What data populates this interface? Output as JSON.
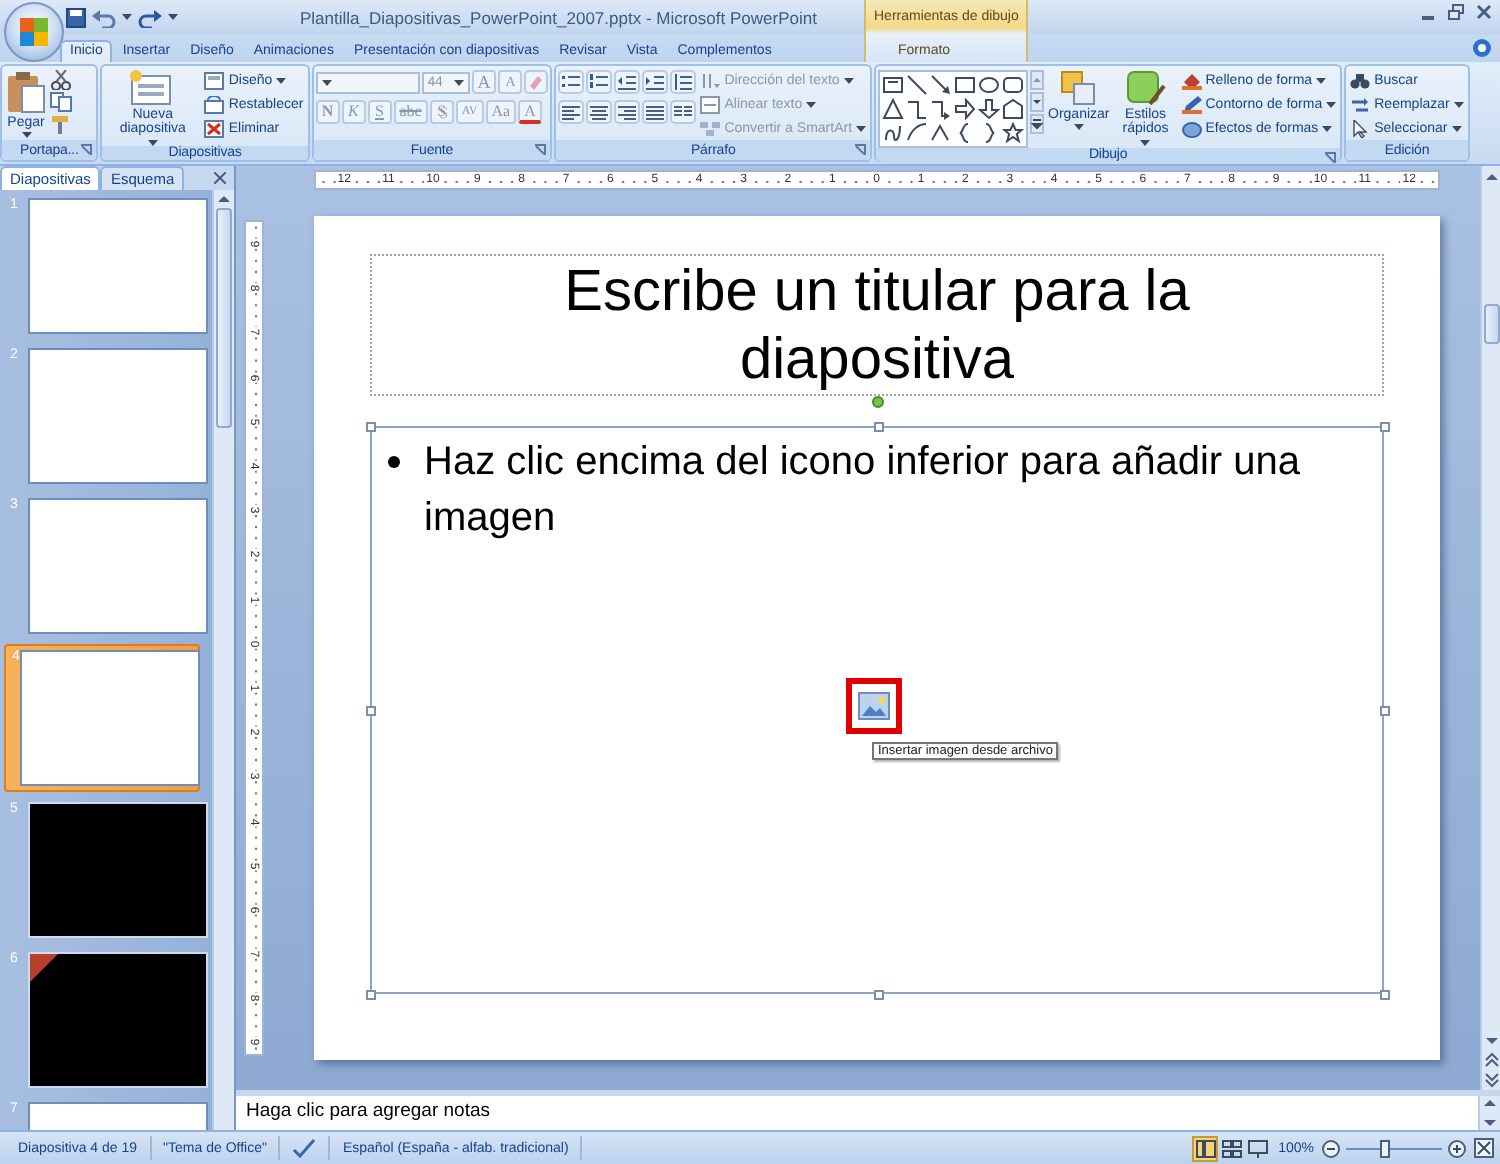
{
  "window": {
    "title": "Plantilla_Diapositivas_PowerPoint_2007.pptx - Microsoft PowerPoint",
    "contextual_group": "Herramientas de dibujo"
  },
  "tabs": [
    {
      "label": "Inicio",
      "selected": true,
      "contextual": false
    },
    {
      "label": "Insertar",
      "selected": false,
      "contextual": false
    },
    {
      "label": "Diseño",
      "selected": false,
      "contextual": false
    },
    {
      "label": "Animaciones",
      "selected": false,
      "contextual": false
    },
    {
      "label": "Presentación con diapositivas",
      "selected": false,
      "contextual": false
    },
    {
      "label": "Revisar",
      "selected": false,
      "contextual": false
    },
    {
      "label": "Vista",
      "selected": false,
      "contextual": false
    },
    {
      "label": "Complementos",
      "selected": false,
      "contextual": false
    },
    {
      "label": "Formato",
      "selected": false,
      "contextual": true
    }
  ],
  "ribbon": {
    "portapapeles": {
      "label": "Portapa...",
      "paste": "Pegar"
    },
    "diapositivas": {
      "label": "Diapositivas",
      "new_slide": "Nueva diapositiva",
      "buttons": [
        "Diseño",
        "Restablecer",
        "Eliminar"
      ]
    },
    "fuente": {
      "label": "Fuente",
      "disabled": true,
      "font_size": "44",
      "size_buttons": [
        "A",
        "A"
      ],
      "format_buttons": [
        {
          "glyph": "N",
          "kind": "bold"
        },
        {
          "glyph": "K",
          "kind": "italic"
        },
        {
          "glyph": "S",
          "kind": "underline"
        },
        {
          "glyph": "abc",
          "kind": "strike"
        },
        {
          "glyph": "S",
          "kind": "shadow"
        },
        {
          "glyph": "AV",
          "kind": "spacing"
        },
        {
          "glyph": "Aa",
          "kind": "case"
        },
        {
          "glyph": "A",
          "kind": "color"
        }
      ]
    },
    "parrafo": {
      "label": "Párrafo",
      "text_buttons": [
        {
          "label": "Dirección del texto",
          "disabled": true
        },
        {
          "label": "Alinear texto",
          "disabled": true
        },
        {
          "label": "Convertir a SmartArt",
          "disabled": true
        }
      ]
    },
    "dibujo": {
      "label": "Dibujo",
      "arrange": "Organizar",
      "quick_styles": "Estilos rápidos",
      "buttons": [
        "Relleno de forma",
        "Contorno de forma",
        "Efectos de formas"
      ]
    },
    "edicion": {
      "label": "Edición",
      "buttons": [
        "Buscar",
        "Reemplazar",
        "Seleccionar"
      ]
    }
  },
  "slides_panel": {
    "tabs": [
      {
        "label": "Diapositivas",
        "selected": true
      },
      {
        "label": "Esquema",
        "selected": false
      }
    ],
    "slides": [
      {
        "number": "1",
        "dark": false,
        "selected": false,
        "marked": false
      },
      {
        "number": "2",
        "dark": false,
        "selected": false,
        "marked": false
      },
      {
        "number": "3",
        "dark": false,
        "selected": false,
        "marked": false
      },
      {
        "number": "4",
        "dark": false,
        "selected": true,
        "marked": false
      },
      {
        "number": "5",
        "dark": true,
        "selected": false,
        "marked": false
      },
      {
        "number": "6",
        "dark": true,
        "selected": false,
        "marked": true
      },
      {
        "number": "7",
        "dark": false,
        "selected": false,
        "marked": false
      }
    ]
  },
  "rulers": {
    "horizontal": [
      "12",
      "11",
      "10",
      "9",
      "8",
      "7",
      "6",
      "5",
      "4",
      "3",
      "2",
      "1",
      "0",
      "1",
      "2",
      "3",
      "4",
      "5",
      "6",
      "7",
      "8",
      "9",
      "10",
      "11",
      "12"
    ],
    "vertical": [
      "9",
      "8",
      "7",
      "6",
      "5",
      "4",
      "3",
      "2",
      "1",
      "0",
      "1",
      "2",
      "3",
      "4",
      "5",
      "6",
      "7",
      "8",
      "9"
    ]
  },
  "slide": {
    "title": "Escribe un titular para la diapositiva",
    "bullet": "Haz clic encima del icono inferior para añadir una imagen",
    "tooltip": "Insertar imagen desde archivo"
  },
  "notes": {
    "placeholder": "Haga clic para agregar notas"
  },
  "status_bar": {
    "slide": "Diapositiva 4 de 19",
    "theme": "\"Tema de Office\"",
    "language": "Español (España - alfab. tradicional)",
    "views": [
      {
        "kind": "normal",
        "selected": true
      },
      {
        "kind": "sorter",
        "selected": false
      },
      {
        "kind": "show",
        "selected": false
      }
    ],
    "zoom": "100%",
    "zoom_slider": {
      "level": 0.4
    }
  }
}
